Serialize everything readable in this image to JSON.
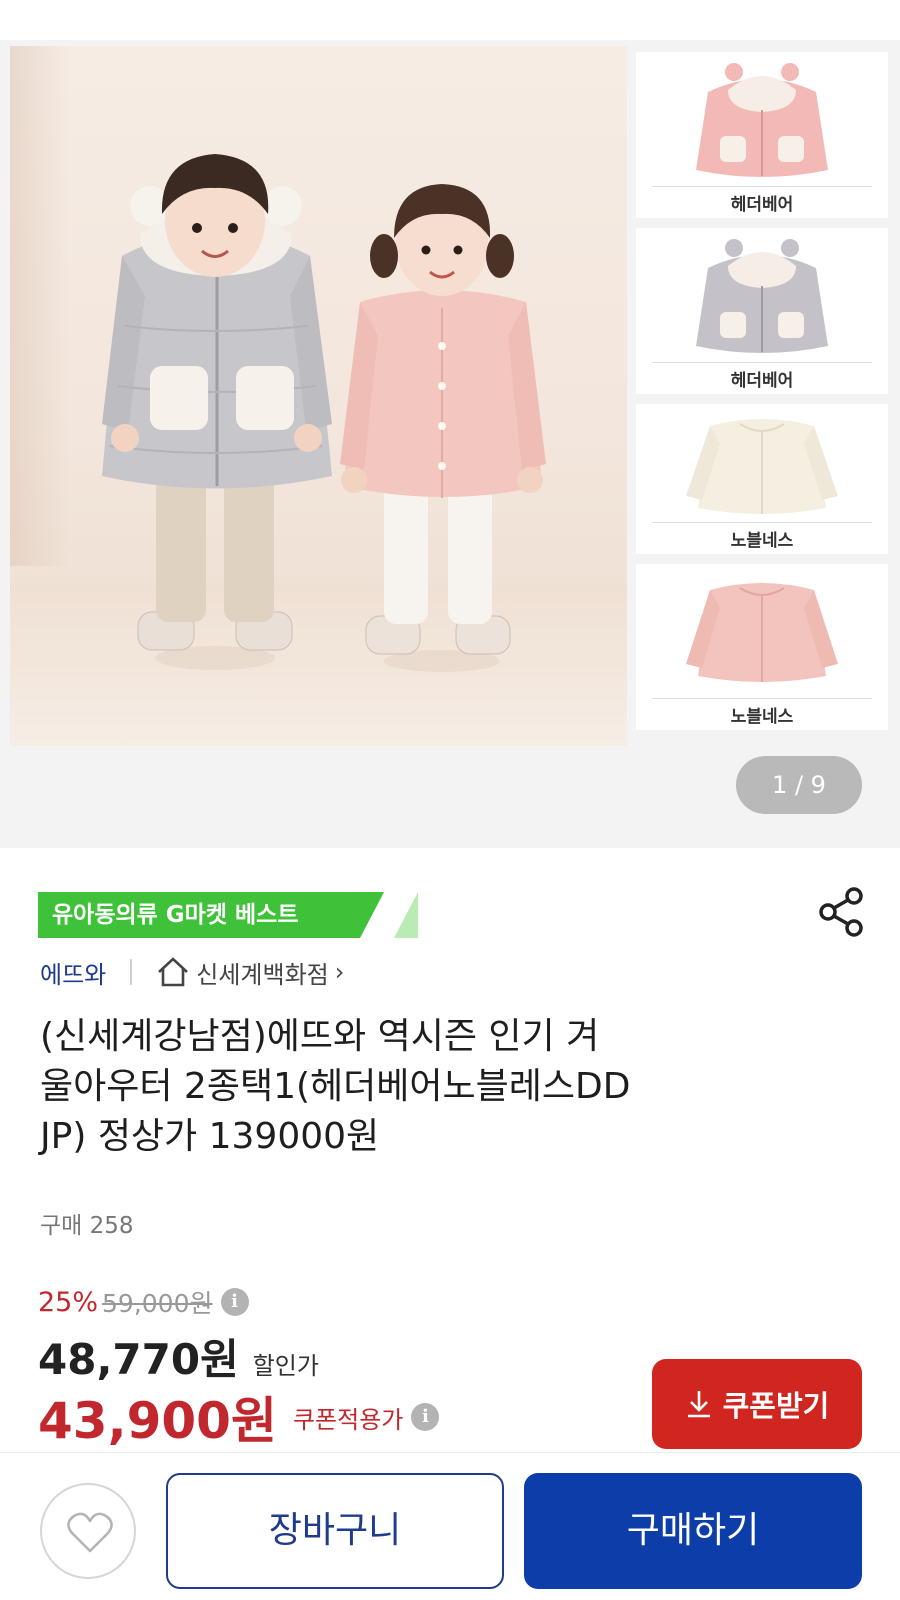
{
  "gallery": {
    "thumbnails": [
      {
        "label": "헤더베어"
      },
      {
        "label": "헤더베어"
      },
      {
        "label": "노블네스"
      },
      {
        "label": "노블네스"
      }
    ],
    "pager": "1 / 9"
  },
  "product": {
    "badge": "유아동의류 G마켓 베스트",
    "brand": "에뜨와",
    "store": "신세계백화점",
    "store_chevron": "›",
    "title_lines": [
      "(신세계강남점)에뜨와 역시즌 인기 겨",
      "울아우터 2종택1(헤더베어노블레스DD",
      "JP) 정상가 139000원"
    ],
    "purchase_count": "구매 258"
  },
  "price": {
    "discount_rate": "25%",
    "original_price": "59,000원",
    "sale_price": "48,770원",
    "sale_price_label": "할인가",
    "coupon_price": "43,900원",
    "coupon_price_label": "쿠폰적용가",
    "info_glyph": "i"
  },
  "actions": {
    "coupon_button": "쿠폰받기",
    "cart_button": "장바구니",
    "buy_button": "구매하기"
  },
  "colors": {
    "badge_green": "#3fc23a",
    "discount_red": "#c1282d",
    "coupon_button_red": "#d1261f",
    "buy_button_blue": "#0d3da8",
    "brand_navy": "#1f3b8c"
  },
  "icons": {
    "share": "share-icon",
    "home": "home-icon",
    "download": "download-icon",
    "heart": "heart-icon",
    "info": "info-icon"
  }
}
